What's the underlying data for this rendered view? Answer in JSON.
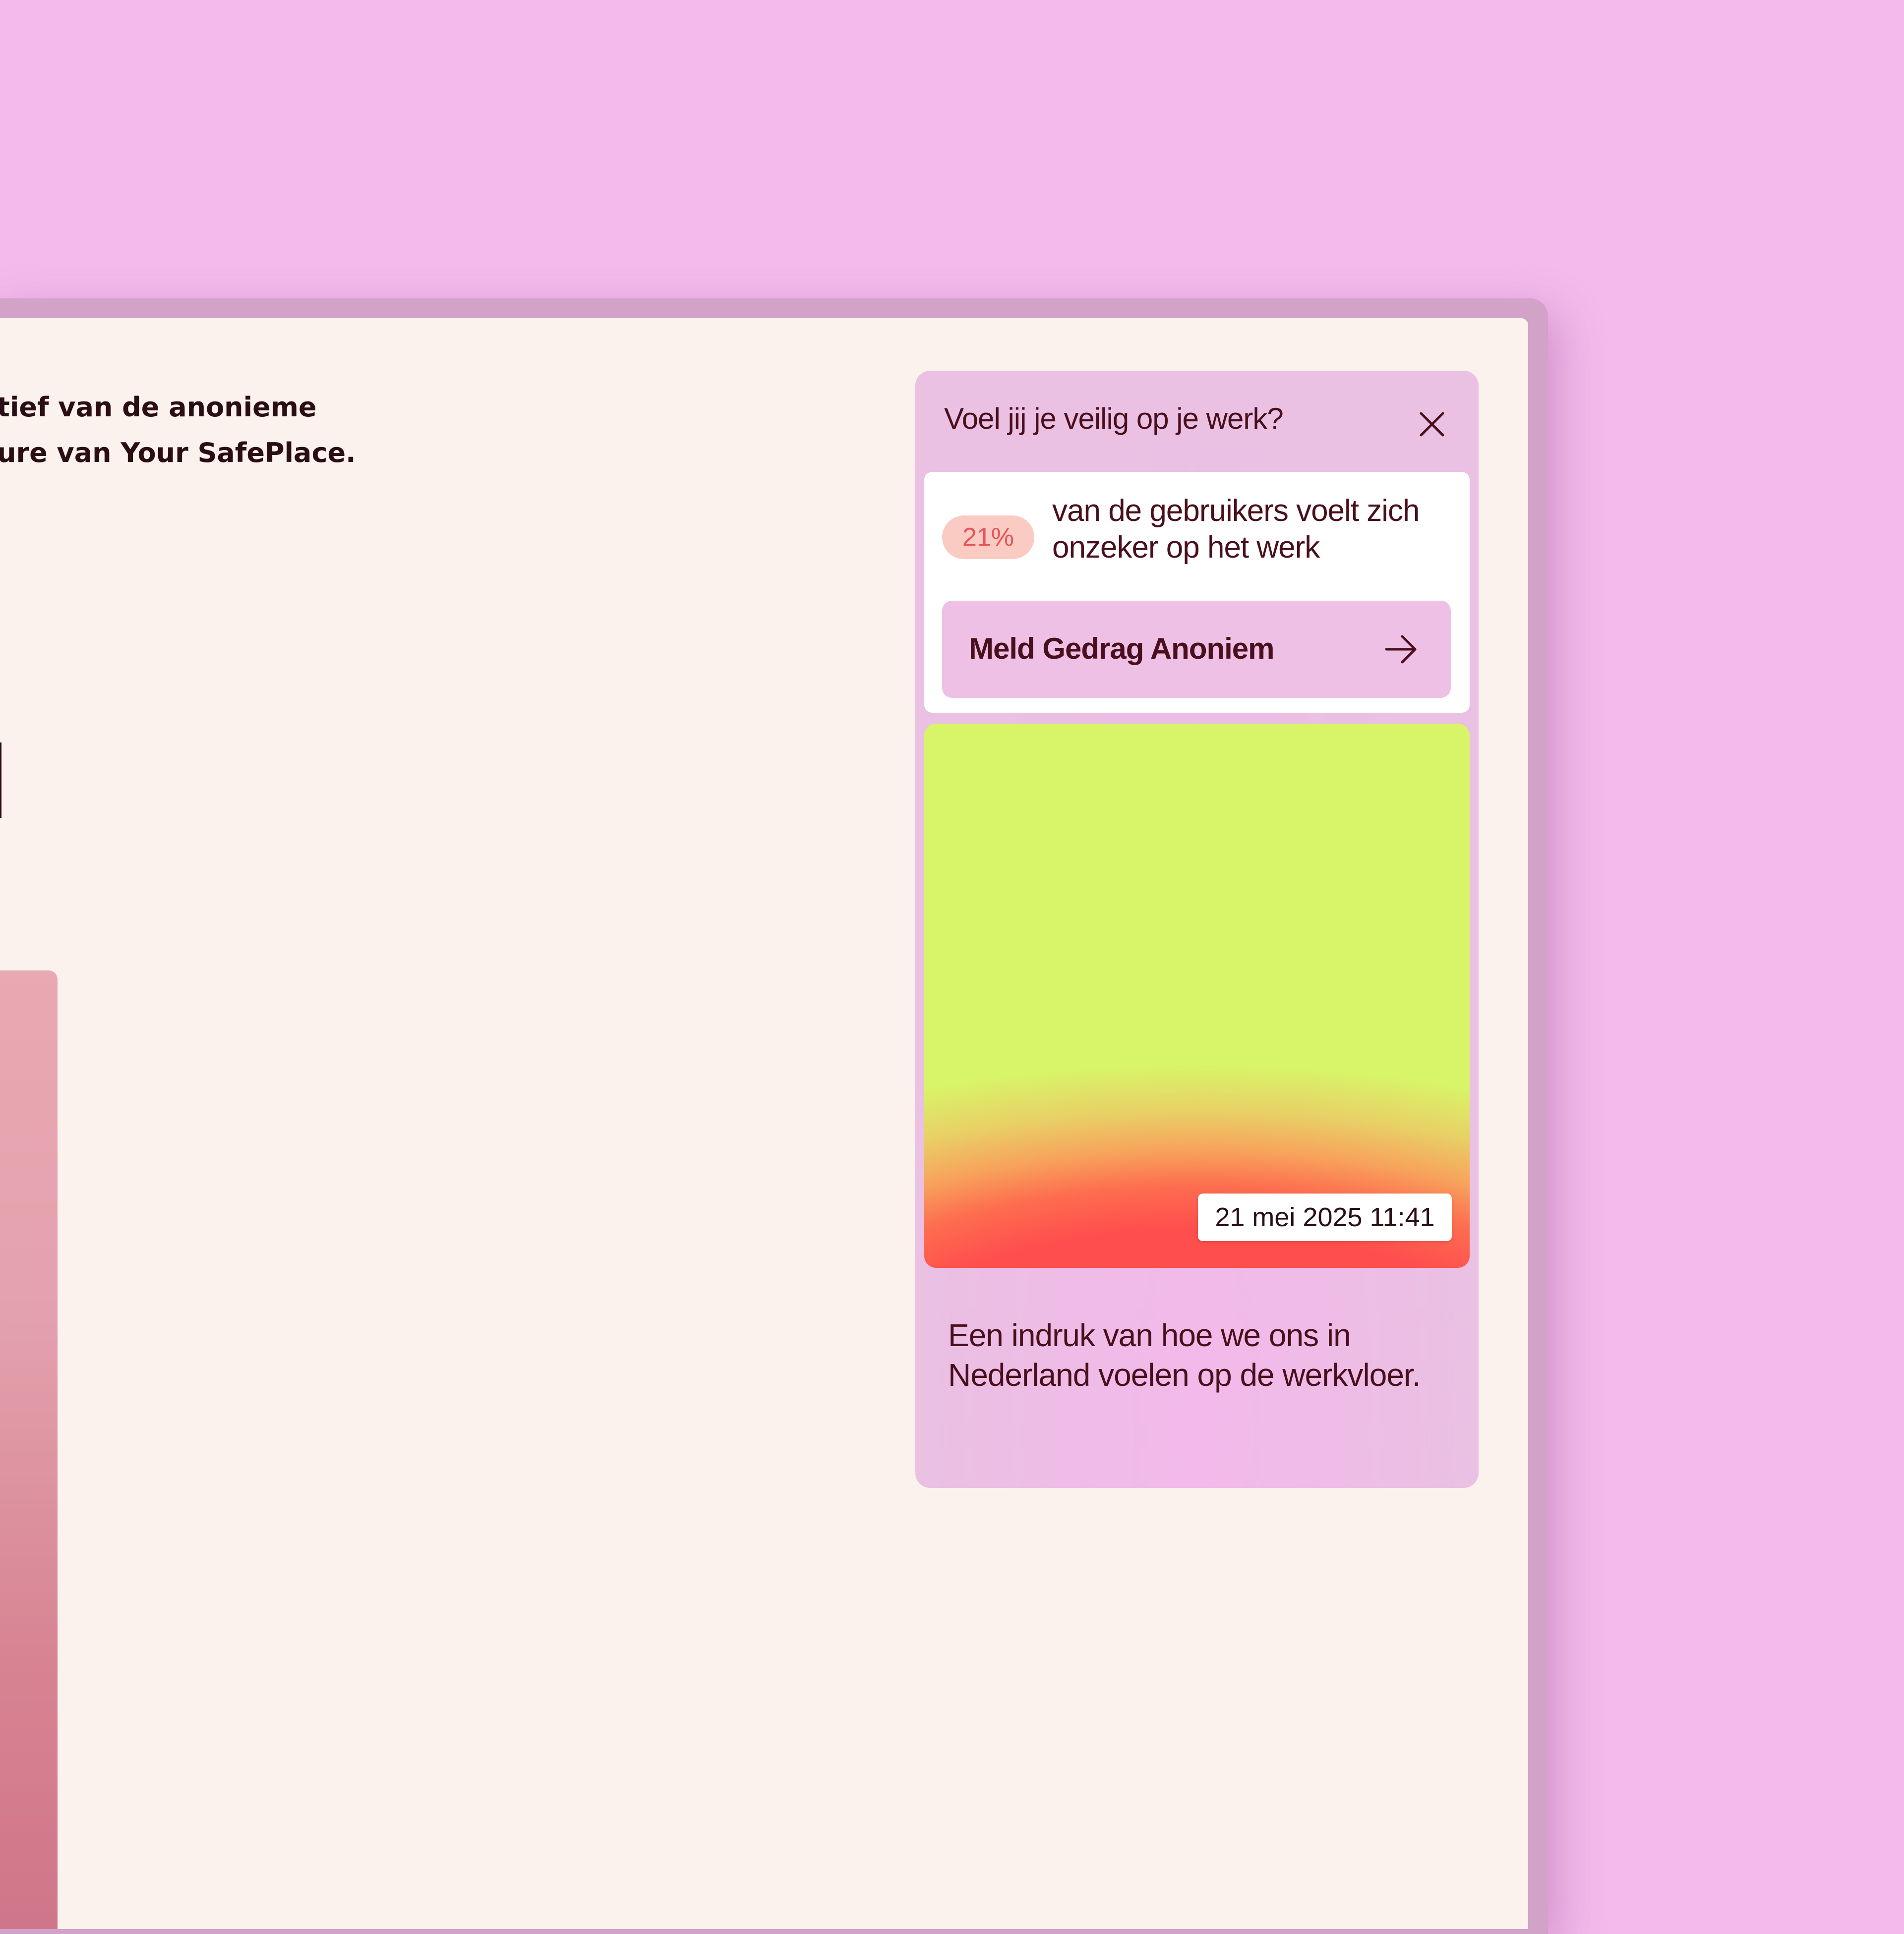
{
  "background": {
    "text_lines": [
      "tief van de anonieme",
      "ure van Your SafePlace."
    ]
  },
  "widget": {
    "title": "Voel jij je veilig op je werk?",
    "close_icon": "close-icon",
    "stat": {
      "percentage": "21%",
      "text": "van de gebruikers voelt zich onzeker op het werk"
    },
    "cta": {
      "label": "Meld Gedrag Anoniem",
      "icon": "arrow-right-icon"
    },
    "timestamp": "21 mei 2025 11:41",
    "caption": "Een indruk van hoe we ons in Nederland voelen op de werkvloer."
  },
  "colors": {
    "page_background": "#f3baeb",
    "screen_background": "#fbf2ed",
    "widget_background": "#eec0e6",
    "text_dark": "#4a0f1c",
    "badge_background": "#f9cbc3",
    "badge_text": "#e8535a",
    "gradient_top": "#d8f468",
    "gradient_bottom": "#ff4e4e"
  }
}
